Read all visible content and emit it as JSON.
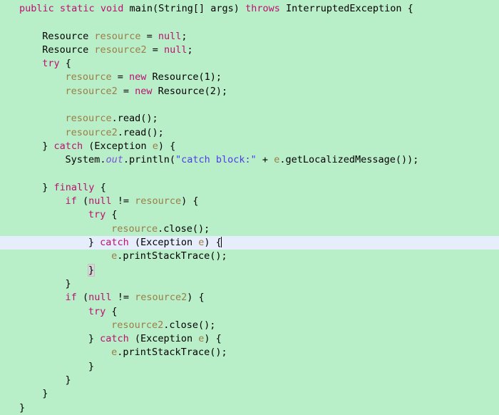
{
  "editor": {
    "language": "java",
    "background_color": "#b8eec8",
    "current_line_highlight_color": "#e6eefc",
    "keyword_color": "#bb1070",
    "variable_color": "#9b7d47",
    "string_color": "#4b3ee8",
    "static_field_color": "#7a52d6",
    "default_text_color": "#000000",
    "bracket_match_color": "#d6d6d6",
    "caret_visible": true,
    "current_line_index": 17,
    "lines": [
      {
        "indent": 0,
        "text": "public static void main(String[] args) throws InterruptedException {"
      },
      {
        "indent": 0,
        "text": ""
      },
      {
        "indent": 4,
        "text": "Resource resource = null;"
      },
      {
        "indent": 4,
        "text": "Resource resource2 = null;"
      },
      {
        "indent": 4,
        "text": "try {"
      },
      {
        "indent": 8,
        "text": "resource = new Resource(1);"
      },
      {
        "indent": 8,
        "text": "resource2 = new Resource(2);"
      },
      {
        "indent": 0,
        "text": ""
      },
      {
        "indent": 8,
        "text": "resource.read();"
      },
      {
        "indent": 8,
        "text": "resource2.read();"
      },
      {
        "indent": 4,
        "text": "} catch (Exception e) {"
      },
      {
        "indent": 8,
        "text": "System.out.println(\"catch block:\" + e.getLocalizedMessage());"
      },
      {
        "indent": 0,
        "text": ""
      },
      {
        "indent": 4,
        "text": "} finally {"
      },
      {
        "indent": 8,
        "text": "if (null != resource) {"
      },
      {
        "indent": 12,
        "text": "try {"
      },
      {
        "indent": 16,
        "text": "resource.close();"
      },
      {
        "indent": 12,
        "text": "} catch (Exception e) {"
      },
      {
        "indent": 16,
        "text": "e.printStackTrace();"
      },
      {
        "indent": 12,
        "text": "}"
      },
      {
        "indent": 8,
        "text": "}"
      },
      {
        "indent": 8,
        "text": "if (null != resource2) {"
      },
      {
        "indent": 12,
        "text": "try {"
      },
      {
        "indent": 16,
        "text": "resource2.close();"
      },
      {
        "indent": 12,
        "text": "} catch (Exception e) {"
      },
      {
        "indent": 16,
        "text": "e.printStackTrace();"
      },
      {
        "indent": 12,
        "text": "}"
      },
      {
        "indent": 8,
        "text": "}"
      },
      {
        "indent": 4,
        "text": "}"
      },
      {
        "indent": 0,
        "text": "}"
      }
    ],
    "tokens": {
      "l0": [
        {
          "t": "public",
          "c": "kw"
        },
        {
          "t": " ",
          "c": "pln"
        },
        {
          "t": "static",
          "c": "kw"
        },
        {
          "t": " ",
          "c": "pln"
        },
        {
          "t": "void",
          "c": "kw"
        },
        {
          "t": " ",
          "c": "pln"
        },
        {
          "t": "main(String[] args) ",
          "c": "pln"
        },
        {
          "t": "throws",
          "c": "kw"
        },
        {
          "t": " ",
          "c": "pln"
        },
        {
          "t": "InterruptedException {",
          "c": "pln"
        }
      ],
      "l2": [
        {
          "t": "Resource ",
          "c": "typ"
        },
        {
          "t": "resource",
          "c": "var"
        },
        {
          "t": " = ",
          "c": "pln"
        },
        {
          "t": "null",
          "c": "kw"
        },
        {
          "t": ";",
          "c": "pln"
        }
      ],
      "l3": [
        {
          "t": "Resource ",
          "c": "typ"
        },
        {
          "t": "resource2",
          "c": "var"
        },
        {
          "t": " = ",
          "c": "pln"
        },
        {
          "t": "null",
          "c": "kw"
        },
        {
          "t": ";",
          "c": "pln"
        }
      ],
      "l4": [
        {
          "t": "try",
          "c": "kw"
        },
        {
          "t": " {",
          "c": "pln"
        }
      ],
      "l5": [
        {
          "t": "resource",
          "c": "var"
        },
        {
          "t": " = ",
          "c": "pln"
        },
        {
          "t": "new",
          "c": "kw"
        },
        {
          "t": " Resource(1);",
          "c": "pln"
        }
      ],
      "l6": [
        {
          "t": "resource2",
          "c": "var"
        },
        {
          "t": " = ",
          "c": "pln"
        },
        {
          "t": "new",
          "c": "kw"
        },
        {
          "t": " Resource(2);",
          "c": "pln"
        }
      ],
      "l8": [
        {
          "t": "resource",
          "c": "var"
        },
        {
          "t": ".read();",
          "c": "pln"
        }
      ],
      "l9": [
        {
          "t": "resource2",
          "c": "var"
        },
        {
          "t": ".read();",
          "c": "pln"
        }
      ],
      "l10": [
        {
          "t": "} ",
          "c": "pln"
        },
        {
          "t": "catch",
          "c": "kw"
        },
        {
          "t": " (Exception ",
          "c": "pln"
        },
        {
          "t": "e",
          "c": "var"
        },
        {
          "t": ") {",
          "c": "pln"
        }
      ],
      "l11": [
        {
          "t": "System.",
          "c": "pln"
        },
        {
          "t": "out",
          "c": "fld"
        },
        {
          "t": ".println(",
          "c": "pln"
        },
        {
          "t": "\"catch block:\"",
          "c": "str"
        },
        {
          "t": " + ",
          "c": "pln"
        },
        {
          "t": "e",
          "c": "var"
        },
        {
          "t": ".getLocalizedMessage());",
          "c": "pln"
        }
      ],
      "l13": [
        {
          "t": "} ",
          "c": "pln"
        },
        {
          "t": "finally",
          "c": "kw"
        },
        {
          "t": " {",
          "c": "pln"
        }
      ],
      "l14": [
        {
          "t": "if",
          "c": "kw"
        },
        {
          "t": " (",
          "c": "pln"
        },
        {
          "t": "null",
          "c": "kw"
        },
        {
          "t": " != ",
          "c": "pln"
        },
        {
          "t": "resource",
          "c": "var"
        },
        {
          "t": ") {",
          "c": "pln"
        }
      ],
      "l15": [
        {
          "t": "try",
          "c": "kw"
        },
        {
          "t": " {",
          "c": "pln"
        }
      ],
      "l16": [
        {
          "t": "resource",
          "c": "var"
        },
        {
          "t": ".close();",
          "c": "pln"
        }
      ],
      "l17": [
        {
          "t": "} ",
          "c": "pln"
        },
        {
          "t": "catch",
          "c": "kw"
        },
        {
          "t": " (Exception ",
          "c": "pln"
        },
        {
          "t": "e",
          "c": "var"
        },
        {
          "t": ") {",
          "c": "pln"
        }
      ],
      "l18": [
        {
          "t": "e",
          "c": "var"
        },
        {
          "t": ".printStackTrace();",
          "c": "pln"
        }
      ],
      "l19": [
        {
          "t": "}",
          "c": "brmatch"
        }
      ],
      "l20": [
        {
          "t": "}",
          "c": "pln"
        }
      ],
      "l21": [
        {
          "t": "if",
          "c": "kw"
        },
        {
          "t": " (",
          "c": "pln"
        },
        {
          "t": "null",
          "c": "kw"
        },
        {
          "t": " != ",
          "c": "pln"
        },
        {
          "t": "resource2",
          "c": "var"
        },
        {
          "t": ") {",
          "c": "pln"
        }
      ],
      "l22": [
        {
          "t": "try",
          "c": "kw"
        },
        {
          "t": " {",
          "c": "pln"
        }
      ],
      "l23": [
        {
          "t": "resource2",
          "c": "var"
        },
        {
          "t": ".close();",
          "c": "pln"
        }
      ],
      "l24": [
        {
          "t": "} ",
          "c": "pln"
        },
        {
          "t": "catch",
          "c": "kw"
        },
        {
          "t": " (Exception ",
          "c": "pln"
        },
        {
          "t": "e",
          "c": "var"
        },
        {
          "t": ") {",
          "c": "pln"
        }
      ],
      "l25": [
        {
          "t": "e",
          "c": "var"
        },
        {
          "t": ".printStackTrace();",
          "c": "pln"
        }
      ],
      "l26": [
        {
          "t": "}",
          "c": "pln"
        }
      ],
      "l27": [
        {
          "t": "}",
          "c": "pln"
        }
      ],
      "l28": [
        {
          "t": "}",
          "c": "pln"
        }
      ],
      "l29": [
        {
          "t": "}",
          "c": "pln"
        }
      ]
    }
  }
}
